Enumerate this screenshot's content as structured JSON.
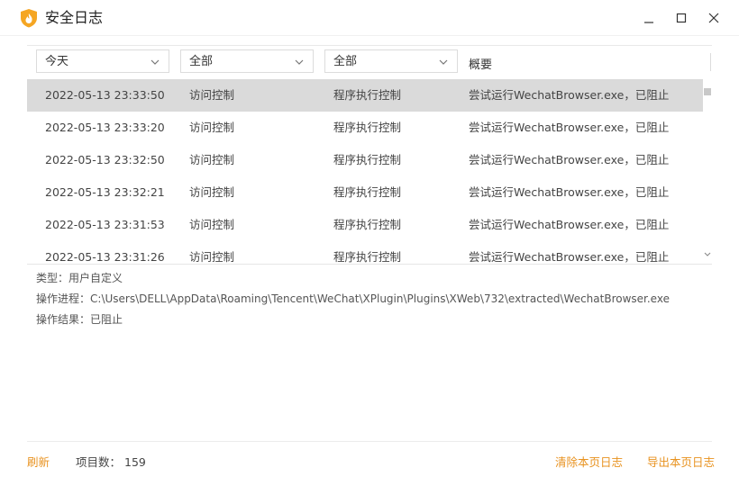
{
  "window": {
    "title": "安全日志",
    "icon": "flame-shield-icon",
    "accent": "#e8921f"
  },
  "filters": {
    "date": "今天",
    "type": "全部",
    "subtype": "全部",
    "summary_header": "概要"
  },
  "rows": [
    {
      "time": "2022-05-13 23:33:50",
      "type": "访问控制",
      "subtype": "程序执行控制",
      "summary": "尝试运行WechatBrowser.exe，已阻止",
      "selected": true
    },
    {
      "time": "2022-05-13 23:33:20",
      "type": "访问控制",
      "subtype": "程序执行控制",
      "summary": "尝试运行WechatBrowser.exe，已阻止"
    },
    {
      "time": "2022-05-13 23:32:50",
      "type": "访问控制",
      "subtype": "程序执行控制",
      "summary": "尝试运行WechatBrowser.exe，已阻止"
    },
    {
      "time": "2022-05-13 23:32:21",
      "type": "访问控制",
      "subtype": "程序执行控制",
      "summary": "尝试运行WechatBrowser.exe，已阻止"
    },
    {
      "time": "2022-05-13 23:31:53",
      "type": "访问控制",
      "subtype": "程序执行控制",
      "summary": "尝试运行WechatBrowser.exe，已阻止"
    },
    {
      "time": "2022-05-13 23:31:26",
      "type": "访问控制",
      "subtype": "程序执行控制",
      "summary": "尝试运行WechatBrowser.exe，已阻止"
    }
  ],
  "details": {
    "type_label": "类型：",
    "type_value": "用户自定义",
    "process_label": "操作进程：",
    "process_value": "C:\\Users\\DELL\\AppData\\Roaming\\Tencent\\WeChat\\XPlugin\\Plugins\\XWeb\\732\\extracted\\WechatBrowser.exe",
    "result_label": "操作结果：",
    "result_value": "已阻止"
  },
  "footer": {
    "refresh": "刷新",
    "count_label": "项目数：",
    "count_value": "159",
    "clear": "清除本页日志",
    "export": "导出本页日志"
  }
}
